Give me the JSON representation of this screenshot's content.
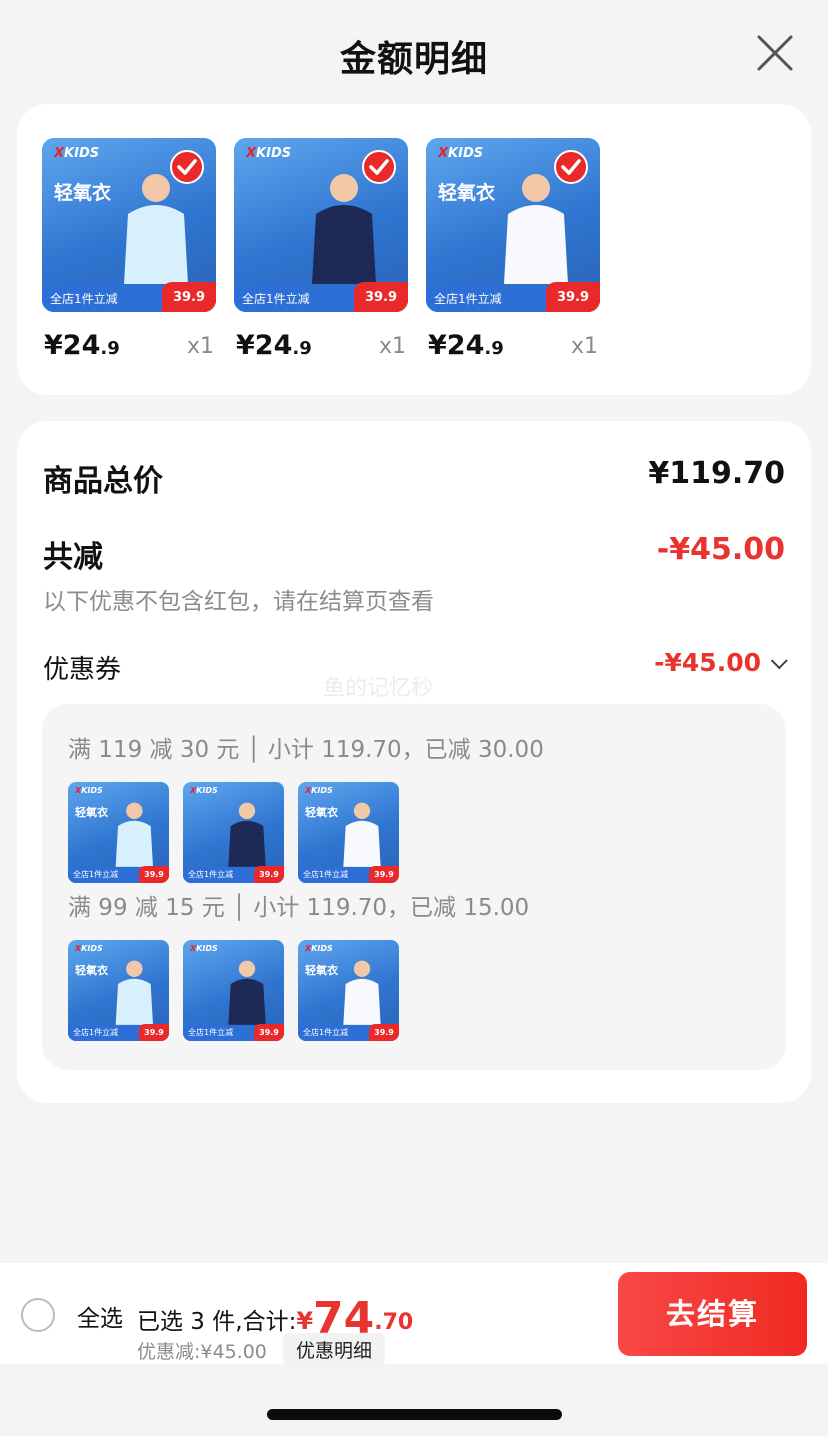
{
  "header": {
    "title": "金额明细"
  },
  "products": [
    {
      "brand": "XKIDS",
      "headline": "轻氧衣",
      "banner": "全店1件立减",
      "tag_price": "39.9",
      "price_int": "¥24",
      "price_dec": ".9",
      "qty": "x1",
      "shirt": "#d8f0fb"
    },
    {
      "brand": "XKIDS",
      "headline": "",
      "banner": "全店1件立减",
      "tag_price": "39.9",
      "price_int": "¥24",
      "price_dec": ".9",
      "qty": "x1",
      "shirt": "#1c2a55"
    },
    {
      "brand": "XKIDS",
      "headline": "轻氧衣",
      "banner": "全店1件立减",
      "tag_price": "39.9",
      "price_int": "¥24",
      "price_dec": ".9",
      "qty": "x1",
      "shirt": "#f7f9fc"
    }
  ],
  "summary": {
    "total_label": "商品总价",
    "total_value": "¥119.70",
    "reduce_label": "共减",
    "reduce_value": "-¥45.00",
    "note": "以下优惠不包含红包，请在结算页查看",
    "coupon_label": "优惠券",
    "coupon_value": "-¥45.00",
    "watermark": "鱼的记忆秒"
  },
  "tiers": [
    {
      "text": "满 119 减 30 元 │ 小计 119.70，已减 30.00"
    },
    {
      "text": "满 99 减 15 元 │ 小计 119.70，已减 15.00"
    }
  ],
  "bottom_bar": {
    "select_all": "全选",
    "selected_text": "已选 3 件,合计:",
    "total_symbol": "¥",
    "total_int": "74",
    "total_dec": ".70",
    "discount_text": "优惠减:¥45.00",
    "detail_chip": "优惠明细",
    "checkout": "去结算"
  },
  "colors": {
    "accent_red": "#e8332e",
    "button_red": "#f02a22",
    "card_bg": "#ffffff",
    "page_bg": "#f4f4f4"
  },
  "icons": [
    "close-icon",
    "check-icon",
    "chevron-down-icon",
    "radio-icon"
  ]
}
